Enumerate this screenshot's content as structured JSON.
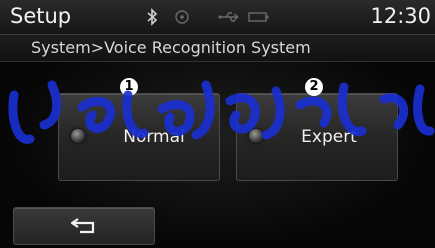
{
  "statusbar": {
    "title": "Setup",
    "clock": "12:30",
    "icons": [
      "bluetooth-icon",
      "disc-icon",
      "usb-icon",
      "battery-icon"
    ]
  },
  "breadcrumb": {
    "path": "System>Voice Recognition System"
  },
  "options": [
    {
      "callout": "1",
      "label": "Normal",
      "selected": false
    },
    {
      "callout": "2",
      "label": "Expert",
      "selected": false
    }
  ],
  "footer": {
    "back_icon": "back-arrow-icon"
  },
  "colors": {
    "background": "#080808",
    "button": "#2e2e2e",
    "text": "#f0f0f0",
    "watermark": "#1a2fd0"
  },
  "watermark": {
    "text": "مرادخودروفارما"
  }
}
